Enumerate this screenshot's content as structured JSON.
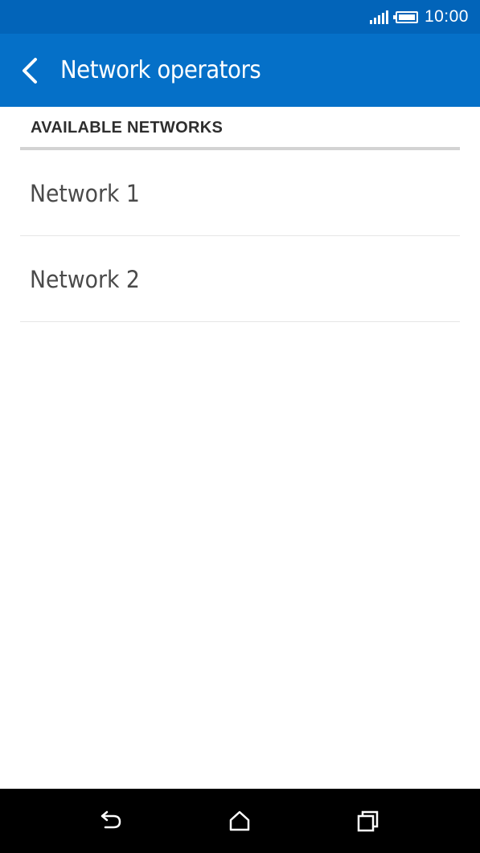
{
  "status_bar": {
    "time": "10:00",
    "signal_icon": "signal-icon",
    "battery_icon": "battery-icon"
  },
  "app_bar": {
    "title": "Network operators",
    "back_icon": "chevron-left-icon",
    "color": "#0570c8"
  },
  "section": {
    "header": "AVAILABLE NETWORKS"
  },
  "networks": [
    {
      "label": "Network 1"
    },
    {
      "label": "Network 2"
    }
  ],
  "nav_bar": {
    "back_icon": "back-arrow-icon",
    "home_icon": "home-icon",
    "recents_icon": "recent-apps-icon"
  }
}
